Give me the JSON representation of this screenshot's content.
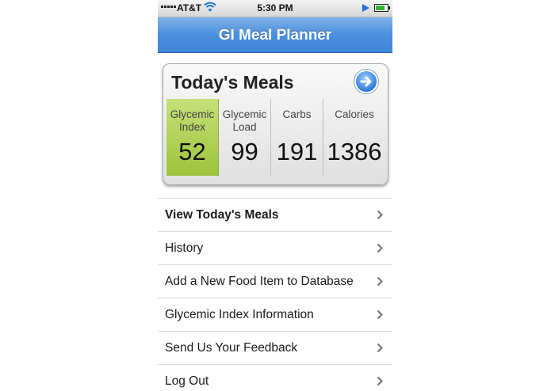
{
  "status_bar": {
    "carrier": "AT&T",
    "time": "5:30 PM"
  },
  "nav": {
    "title": "GI Meal Planner"
  },
  "summary_card": {
    "title": "Today's Meals",
    "stats": [
      {
        "label_line1": "Glycemic",
        "label_line2": "Index",
        "value": "52"
      },
      {
        "label_line1": "Glycemic",
        "label_line2": "Load",
        "value": "99"
      },
      {
        "label_line1": "Carbs",
        "label_line2": "",
        "value": "191"
      },
      {
        "label_line1": "Calories",
        "label_line2": "",
        "value": "1386"
      }
    ],
    "highlight_color": "#b5d65a"
  },
  "menu": {
    "items": [
      {
        "label": "View Today's Meals"
      },
      {
        "label": "History"
      },
      {
        "label": "Add a New Food Item to Database"
      },
      {
        "label": "Glycemic Index Information"
      },
      {
        "label": "Send Us Your Feedback"
      },
      {
        "label": "Log Out"
      }
    ]
  },
  "colors": {
    "nav_blue": "#4a8fdc",
    "accent_blue": "#1f72d6"
  }
}
